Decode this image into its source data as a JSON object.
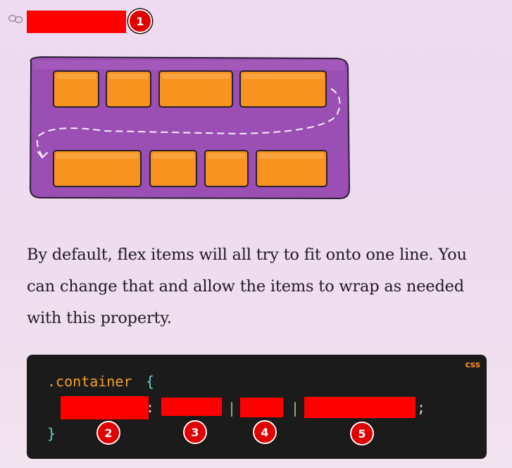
{
  "heading": {
    "link_icon": "link-icon",
    "badge": "1"
  },
  "illustration": {
    "description_icon": "flex-wrap-diagram",
    "colors": {
      "container": "#9b59b6",
      "item": "#f7931e"
    }
  },
  "description": "By default, flex items will all try to fit onto one line. You can change that and allow the items to wrap as needed with this property.",
  "code": {
    "language": "css",
    "selector": ".container",
    "open_brace": "{",
    "close_brace": "}",
    "colon": ":",
    "separator": "|",
    "semicolon": ";",
    "badges": [
      "2",
      "3",
      "4",
      "5"
    ]
  }
}
